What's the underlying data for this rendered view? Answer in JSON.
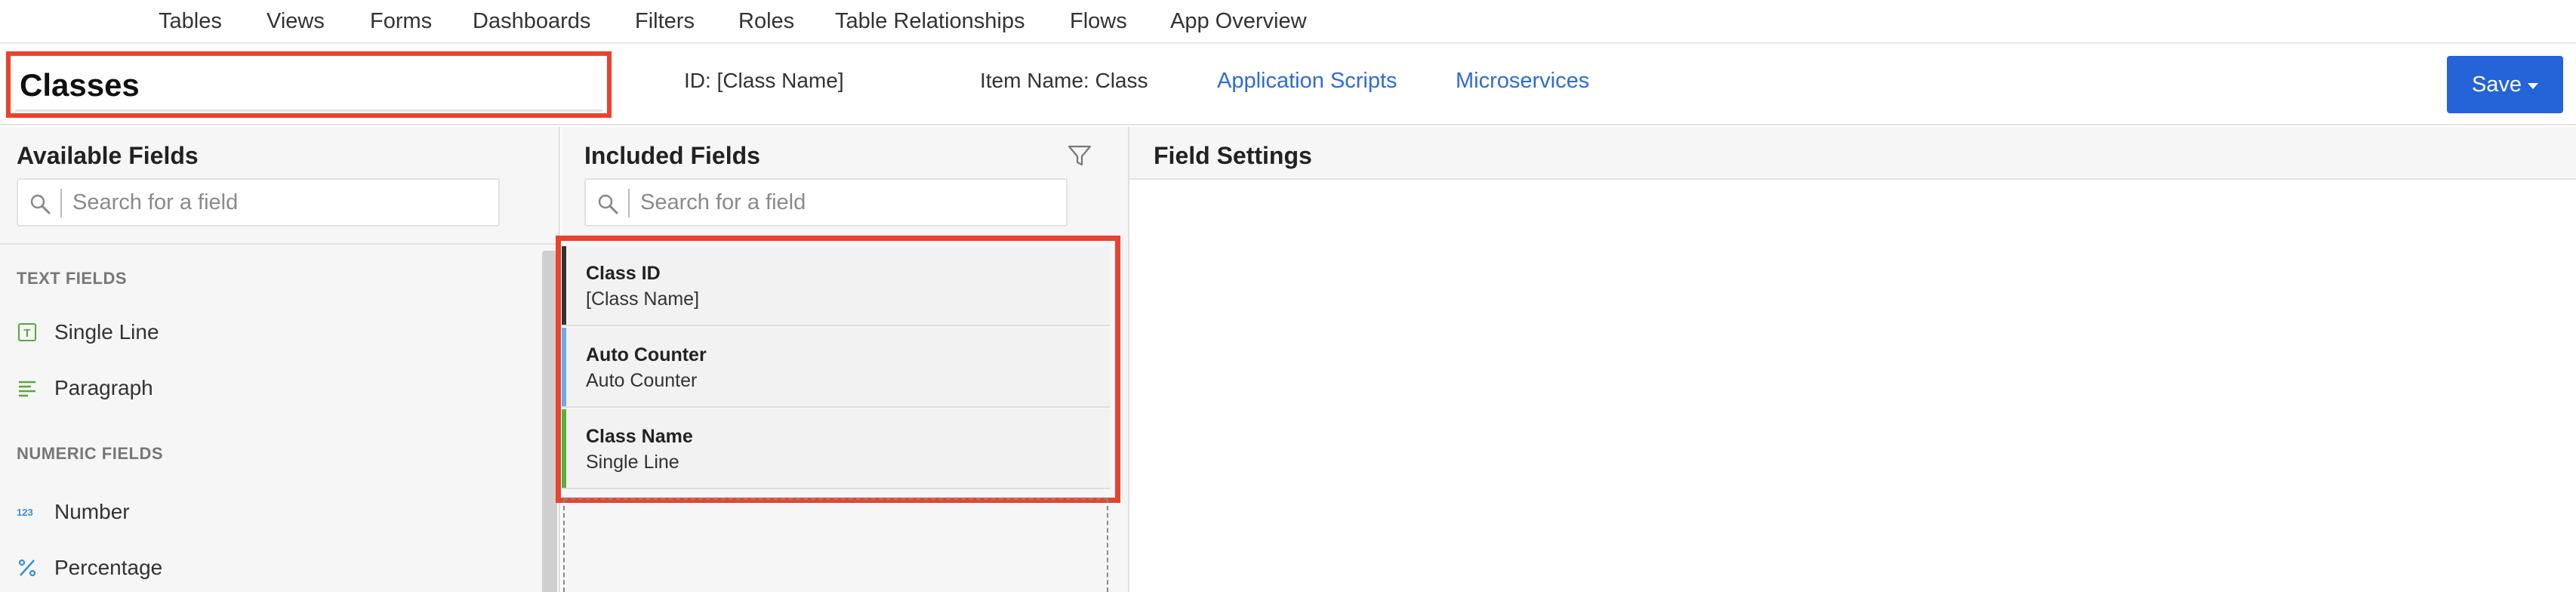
{
  "nav": {
    "items": [
      "Tables",
      "Views",
      "Forms",
      "Dashboards",
      "Filters",
      "Roles",
      "Table Relationships",
      "Flows",
      "App Overview"
    ]
  },
  "header": {
    "table_name": "Classes",
    "id_label": "ID: [Class Name]",
    "item_name_label": "Item Name: Class",
    "links": [
      "Application Scripts",
      "Microservices"
    ],
    "save_label": "Save"
  },
  "available": {
    "title": "Available Fields",
    "search_placeholder": "Search for a field",
    "sections": [
      {
        "label": "TEXT FIELDS",
        "items": [
          {
            "label": "Single Line",
            "icon": "single-line-icon"
          },
          {
            "label": "Paragraph",
            "icon": "paragraph-icon"
          }
        ]
      },
      {
        "label": "NUMERIC FIELDS",
        "items": [
          {
            "label": "Number",
            "icon": "number-icon"
          },
          {
            "label": "Percentage",
            "icon": "percentage-icon"
          }
        ]
      }
    ]
  },
  "included": {
    "title": "Included Fields",
    "search_placeholder": "Search for a field",
    "items": [
      {
        "name": "Class ID",
        "type": "[Class Name]",
        "color": "#333333"
      },
      {
        "name": "Auto Counter",
        "type": "Auto Counter",
        "color": "#6fa8e8"
      },
      {
        "name": "Class Name",
        "type": "Single Line",
        "color": "#57b03a"
      }
    ]
  },
  "settings": {
    "title": "Field Settings"
  },
  "colors": {
    "accent": "#2563d9",
    "link": "#2f6bd6",
    "highlight": "#e8432e"
  }
}
